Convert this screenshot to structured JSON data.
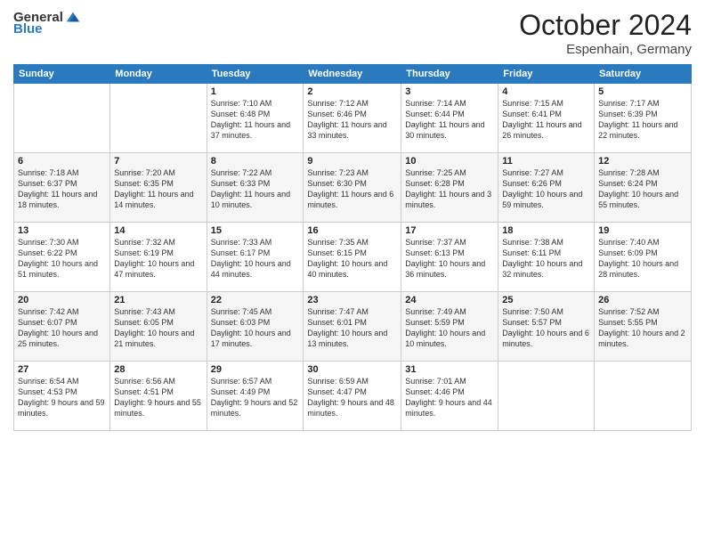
{
  "header": {
    "logo_general": "General",
    "logo_blue": "Blue",
    "month": "October 2024",
    "location": "Espenhain, Germany"
  },
  "weekdays": [
    "Sunday",
    "Monday",
    "Tuesday",
    "Wednesday",
    "Thursday",
    "Friday",
    "Saturday"
  ],
  "weeks": [
    [
      {
        "day": "",
        "sunrise": "",
        "sunset": "",
        "daylight": ""
      },
      {
        "day": "",
        "sunrise": "",
        "sunset": "",
        "daylight": ""
      },
      {
        "day": "1",
        "sunrise": "Sunrise: 7:10 AM",
        "sunset": "Sunset: 6:48 PM",
        "daylight": "Daylight: 11 hours and 37 minutes."
      },
      {
        "day": "2",
        "sunrise": "Sunrise: 7:12 AM",
        "sunset": "Sunset: 6:46 PM",
        "daylight": "Daylight: 11 hours and 33 minutes."
      },
      {
        "day": "3",
        "sunrise": "Sunrise: 7:14 AM",
        "sunset": "Sunset: 6:44 PM",
        "daylight": "Daylight: 11 hours and 30 minutes."
      },
      {
        "day": "4",
        "sunrise": "Sunrise: 7:15 AM",
        "sunset": "Sunset: 6:41 PM",
        "daylight": "Daylight: 11 hours and 26 minutes."
      },
      {
        "day": "5",
        "sunrise": "Sunrise: 7:17 AM",
        "sunset": "Sunset: 6:39 PM",
        "daylight": "Daylight: 11 hours and 22 minutes."
      }
    ],
    [
      {
        "day": "6",
        "sunrise": "Sunrise: 7:18 AM",
        "sunset": "Sunset: 6:37 PM",
        "daylight": "Daylight: 11 hours and 18 minutes."
      },
      {
        "day": "7",
        "sunrise": "Sunrise: 7:20 AM",
        "sunset": "Sunset: 6:35 PM",
        "daylight": "Daylight: 11 hours and 14 minutes."
      },
      {
        "day": "8",
        "sunrise": "Sunrise: 7:22 AM",
        "sunset": "Sunset: 6:33 PM",
        "daylight": "Daylight: 11 hours and 10 minutes."
      },
      {
        "day": "9",
        "sunrise": "Sunrise: 7:23 AM",
        "sunset": "Sunset: 6:30 PM",
        "daylight": "Daylight: 11 hours and 6 minutes."
      },
      {
        "day": "10",
        "sunrise": "Sunrise: 7:25 AM",
        "sunset": "Sunset: 6:28 PM",
        "daylight": "Daylight: 11 hours and 3 minutes."
      },
      {
        "day": "11",
        "sunrise": "Sunrise: 7:27 AM",
        "sunset": "Sunset: 6:26 PM",
        "daylight": "Daylight: 10 hours and 59 minutes."
      },
      {
        "day": "12",
        "sunrise": "Sunrise: 7:28 AM",
        "sunset": "Sunset: 6:24 PM",
        "daylight": "Daylight: 10 hours and 55 minutes."
      }
    ],
    [
      {
        "day": "13",
        "sunrise": "Sunrise: 7:30 AM",
        "sunset": "Sunset: 6:22 PM",
        "daylight": "Daylight: 10 hours and 51 minutes."
      },
      {
        "day": "14",
        "sunrise": "Sunrise: 7:32 AM",
        "sunset": "Sunset: 6:19 PM",
        "daylight": "Daylight: 10 hours and 47 minutes."
      },
      {
        "day": "15",
        "sunrise": "Sunrise: 7:33 AM",
        "sunset": "Sunset: 6:17 PM",
        "daylight": "Daylight: 10 hours and 44 minutes."
      },
      {
        "day": "16",
        "sunrise": "Sunrise: 7:35 AM",
        "sunset": "Sunset: 6:15 PM",
        "daylight": "Daylight: 10 hours and 40 minutes."
      },
      {
        "day": "17",
        "sunrise": "Sunrise: 7:37 AM",
        "sunset": "Sunset: 6:13 PM",
        "daylight": "Daylight: 10 hours and 36 minutes."
      },
      {
        "day": "18",
        "sunrise": "Sunrise: 7:38 AM",
        "sunset": "Sunset: 6:11 PM",
        "daylight": "Daylight: 10 hours and 32 minutes."
      },
      {
        "day": "19",
        "sunrise": "Sunrise: 7:40 AM",
        "sunset": "Sunset: 6:09 PM",
        "daylight": "Daylight: 10 hours and 28 minutes."
      }
    ],
    [
      {
        "day": "20",
        "sunrise": "Sunrise: 7:42 AM",
        "sunset": "Sunset: 6:07 PM",
        "daylight": "Daylight: 10 hours and 25 minutes."
      },
      {
        "day": "21",
        "sunrise": "Sunrise: 7:43 AM",
        "sunset": "Sunset: 6:05 PM",
        "daylight": "Daylight: 10 hours and 21 minutes."
      },
      {
        "day": "22",
        "sunrise": "Sunrise: 7:45 AM",
        "sunset": "Sunset: 6:03 PM",
        "daylight": "Daylight: 10 hours and 17 minutes."
      },
      {
        "day": "23",
        "sunrise": "Sunrise: 7:47 AM",
        "sunset": "Sunset: 6:01 PM",
        "daylight": "Daylight: 10 hours and 13 minutes."
      },
      {
        "day": "24",
        "sunrise": "Sunrise: 7:49 AM",
        "sunset": "Sunset: 5:59 PM",
        "daylight": "Daylight: 10 hours and 10 minutes."
      },
      {
        "day": "25",
        "sunrise": "Sunrise: 7:50 AM",
        "sunset": "Sunset: 5:57 PM",
        "daylight": "Daylight: 10 hours and 6 minutes."
      },
      {
        "day": "26",
        "sunrise": "Sunrise: 7:52 AM",
        "sunset": "Sunset: 5:55 PM",
        "daylight": "Daylight: 10 hours and 2 minutes."
      }
    ],
    [
      {
        "day": "27",
        "sunrise": "Sunrise: 6:54 AM",
        "sunset": "Sunset: 4:53 PM",
        "daylight": "Daylight: 9 hours and 59 minutes."
      },
      {
        "day": "28",
        "sunrise": "Sunrise: 6:56 AM",
        "sunset": "Sunset: 4:51 PM",
        "daylight": "Daylight: 9 hours and 55 minutes."
      },
      {
        "day": "29",
        "sunrise": "Sunrise: 6:57 AM",
        "sunset": "Sunset: 4:49 PM",
        "daylight": "Daylight: 9 hours and 52 minutes."
      },
      {
        "day": "30",
        "sunrise": "Sunrise: 6:59 AM",
        "sunset": "Sunset: 4:47 PM",
        "daylight": "Daylight: 9 hours and 48 minutes."
      },
      {
        "day": "31",
        "sunrise": "Sunrise: 7:01 AM",
        "sunset": "Sunset: 4:46 PM",
        "daylight": "Daylight: 9 hours and 44 minutes."
      },
      {
        "day": "",
        "sunrise": "",
        "sunset": "",
        "daylight": ""
      },
      {
        "day": "",
        "sunrise": "",
        "sunset": "",
        "daylight": ""
      }
    ]
  ]
}
